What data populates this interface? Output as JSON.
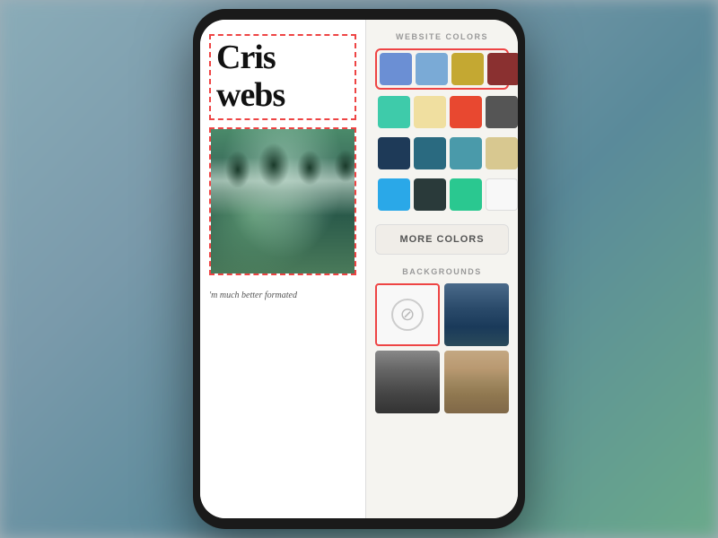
{
  "background": {
    "color": "#8aacb8"
  },
  "preview": {
    "title_line1": "Cris",
    "title_line2": "webs",
    "body_text": "'m much better formated "
  },
  "color_panel": {
    "website_colors_label": "WEBSITE COLORS",
    "more_colors_label": "MORE COLORS",
    "backgrounds_label": "BACKGROUNDS",
    "color_rows": [
      {
        "id": "row1",
        "selected": true,
        "colors": [
          "#6b8fd4",
          "#7aaad6",
          "#c4a832",
          "#8a3030"
        ]
      },
      {
        "id": "row2",
        "selected": false,
        "colors": [
          "#3ecbaa",
          "#f0dfa0",
          "#e84830",
          "#555555"
        ]
      },
      {
        "id": "row3",
        "selected": false,
        "colors": [
          "#1e3a58",
          "#2a6a80",
          "#4a9aaa",
          "#d8c890"
        ]
      },
      {
        "id": "row4",
        "selected": false,
        "colors": [
          "#2aa8e8",
          "#2a3a3a",
          "#2ac890",
          "#f8f8f8"
        ]
      }
    ],
    "backgrounds": [
      {
        "id": "bg-none",
        "type": "none",
        "selected": true
      },
      {
        "id": "bg-ocean",
        "type": "ocean",
        "selected": false
      },
      {
        "id": "bg-city",
        "type": "city",
        "selected": false
      },
      {
        "id": "bg-buildings",
        "type": "buildings",
        "selected": false
      }
    ]
  }
}
